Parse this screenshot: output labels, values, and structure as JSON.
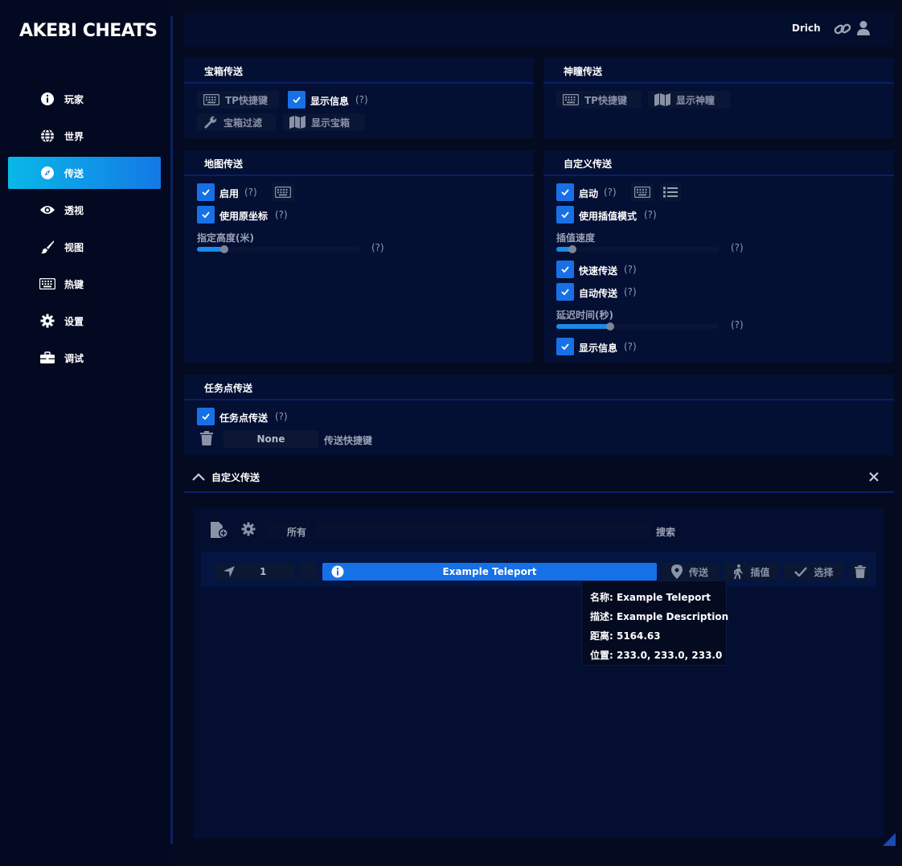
{
  "app": {
    "logo": "AKEBI CHEATS"
  },
  "topbar": {
    "username": "Drich"
  },
  "sidebar": {
    "items": [
      {
        "label": "玩家",
        "icon": "info-icon"
      },
      {
        "label": "世界",
        "icon": "globe-icon"
      },
      {
        "label": "传送",
        "icon": "compass-icon",
        "active": true
      },
      {
        "label": "透视",
        "icon": "eye-icon"
      },
      {
        "label": "视图",
        "icon": "brush-icon"
      },
      {
        "label": "热键",
        "icon": "keyboard-icon"
      },
      {
        "label": "设置",
        "icon": "gear-icon"
      },
      {
        "label": "调试",
        "icon": "toolbox-icon"
      }
    ]
  },
  "chest_tp": {
    "title": "宝箱传送",
    "tp_hotkey": "TP快捷键",
    "show_info": "显示信息",
    "help": "(?)",
    "filter": "宝箱过滤",
    "show_chests": "显示宝箱"
  },
  "oculi_tp": {
    "title": "神瞳传送",
    "tp_hotkey": "TP快捷键",
    "show_oculi": "显示神瞳"
  },
  "map_tp": {
    "title": "地图传送",
    "enable": "启用",
    "use_orig_coords": "使用原坐标",
    "height_label": "指定高度(米)",
    "height_fill": 0.17,
    "help": "(?)"
  },
  "custom_tp_panel": {
    "title": "自定义传送",
    "enable": "启动",
    "use_interp": "使用插值模式",
    "interp_speed": "插值速度",
    "interp_fill": 0.1,
    "fast_tp": "快速传送",
    "auto_tp": "自动传送",
    "delay_label": "延迟时间(秒)",
    "delay_fill": 0.33,
    "show_info": "显示信息",
    "help": "(?)"
  },
  "quest_tp": {
    "title": "任务点传送",
    "enable": "任务点传送",
    "help": "(?)",
    "hotkey_value": "None",
    "hotkey_label": "传送快捷键"
  },
  "custom_window": {
    "title": "自定义传送",
    "filter_all": "所有",
    "search_label": "搜索",
    "row": {
      "index": "1",
      "name": "Example Teleport",
      "teleport": "传送",
      "interpolate": "插值",
      "select": "选择"
    },
    "tooltip": {
      "name": "名称: Example Teleport",
      "desc": "描述: Example Description",
      "distance": "距离: 5164.63",
      "position": "位置: 233.0, 233.0, 233.0"
    }
  },
  "colors": {
    "accent": "#1670e6",
    "accent_start": "#09b8e8",
    "panel": "#030f33",
    "bg": "#040a20"
  }
}
